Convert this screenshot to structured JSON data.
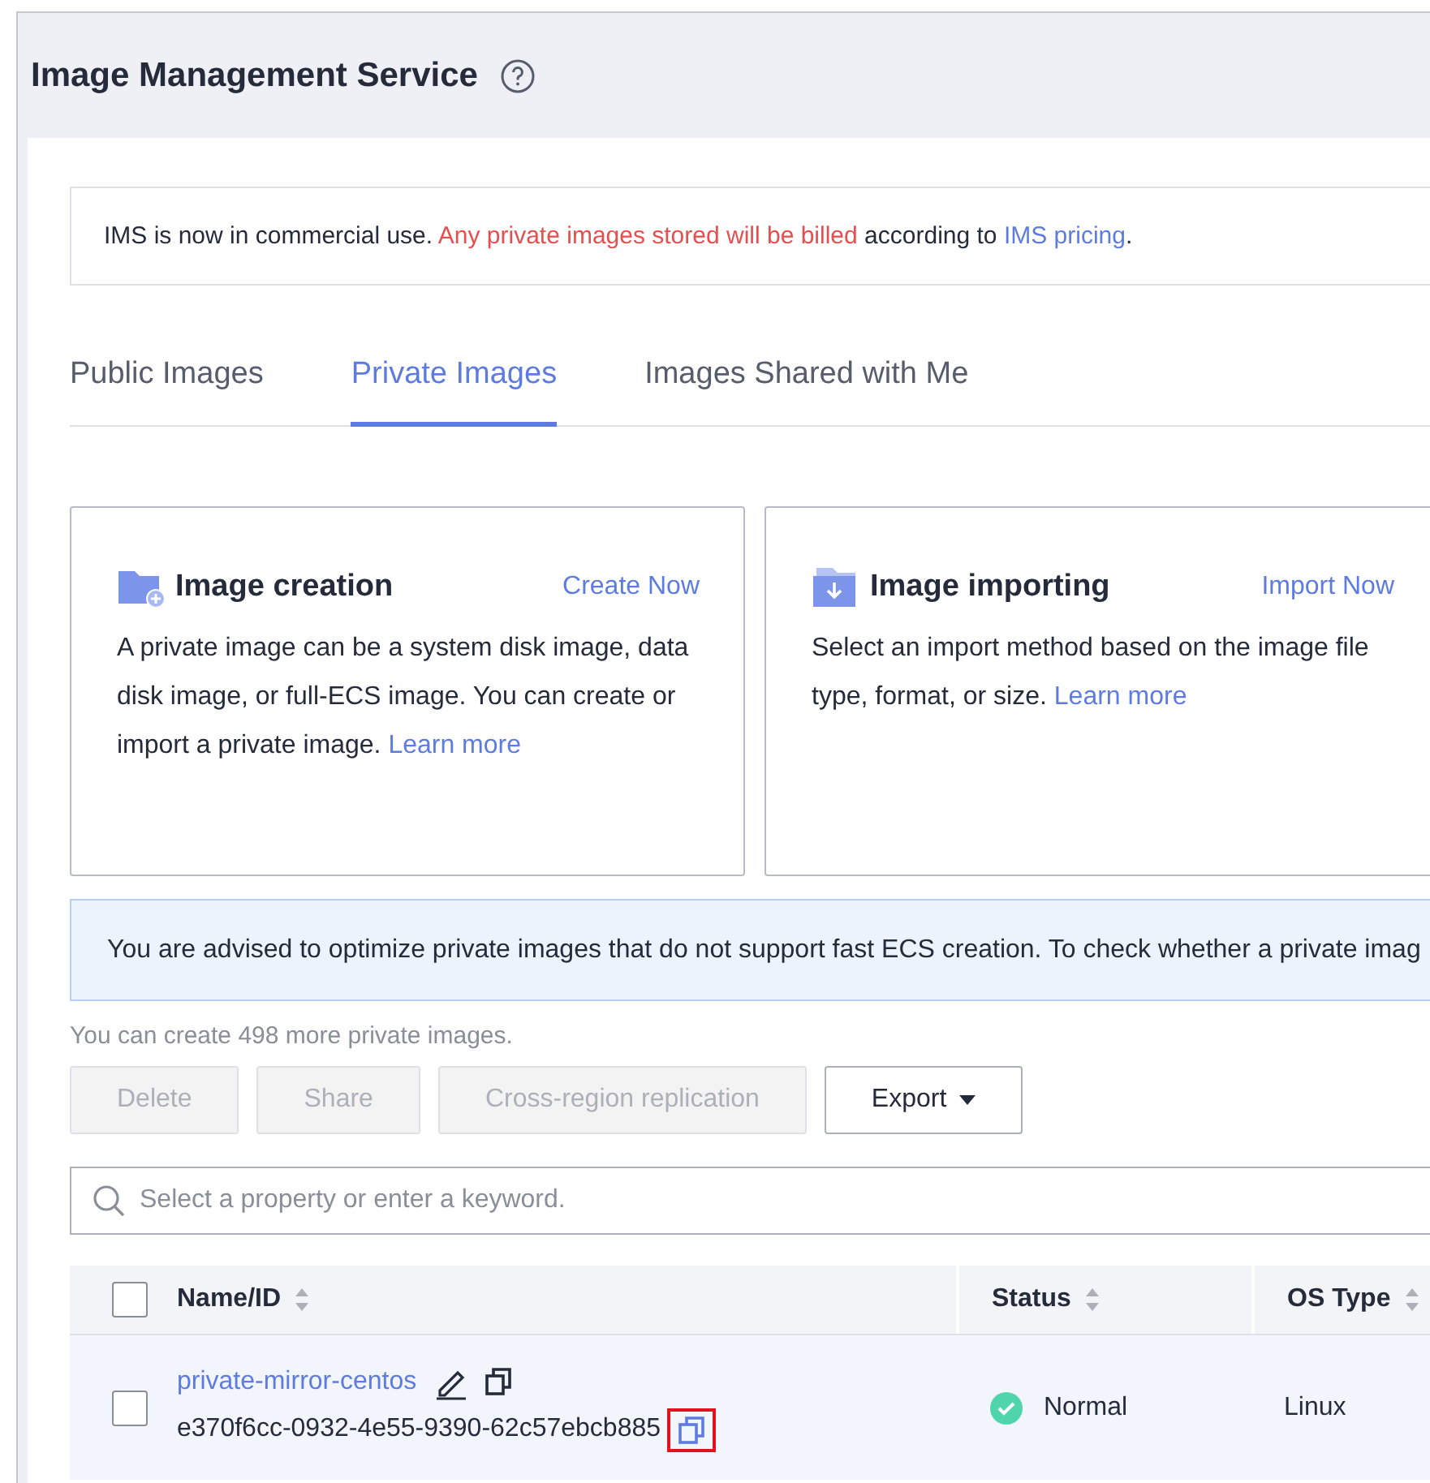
{
  "header": {
    "title": "Image Management Service"
  },
  "notice": {
    "parts": [
      {
        "kind": "plain",
        "text": "IMS is now in commercial use. "
      },
      {
        "kind": "warning",
        "text": "Any private images stored will be billed"
      },
      {
        "kind": "plain",
        "text": " according to "
      },
      {
        "kind": "link",
        "text": "IMS pricing"
      },
      {
        "kind": "plain",
        "text": "."
      }
    ]
  },
  "tabs": [
    {
      "label": "Public Images",
      "selected": false
    },
    {
      "label": "Private Images",
      "selected": true
    },
    {
      "label": "Images Shared with Me",
      "selected": false
    }
  ],
  "cards": [
    {
      "kind": "create",
      "title": "Image creation",
      "action": "Create Now",
      "description": "A private image can be a system disk image, data disk image, or full-ECS image. You can create or import a private image.",
      "link": "Learn more"
    },
    {
      "kind": "import",
      "title": "Image importing",
      "action": "Import Now",
      "description": "Select an import method based on the image file type, format, or size.",
      "link": "Learn more"
    }
  ],
  "advisory": "You are advised to optimize private images that do not support fast ECS creation. To check whether a private imag",
  "quota": "You can create 498 more private images.",
  "actions": [
    {
      "kind": "button",
      "label": "Delete",
      "disabled": true
    },
    {
      "kind": "button",
      "label": "Share",
      "disabled": true
    },
    {
      "kind": "button",
      "label": "Cross-region replication",
      "disabled": true
    },
    {
      "kind": "dropdown",
      "label": "Export",
      "disabled": false
    }
  ],
  "search": {
    "placeholder": "Select a property or enter a keyword."
  },
  "table": {
    "select_all": {
      "checked": false
    },
    "columns": [
      {
        "label": "Name/ID",
        "sortable": true
      },
      {
        "label": "Status",
        "sortable": true
      },
      {
        "label": "OS Type",
        "sortable": true
      }
    ],
    "rows": [
      {
        "checked": false,
        "name": "private-mirror-centos",
        "id": "e370f6cc-0932-4e55-9390-62c57ebcb885",
        "id_copy_highlighted": true,
        "status": "Normal",
        "status_ok": true,
        "os_type": "Linux"
      }
    ]
  }
}
